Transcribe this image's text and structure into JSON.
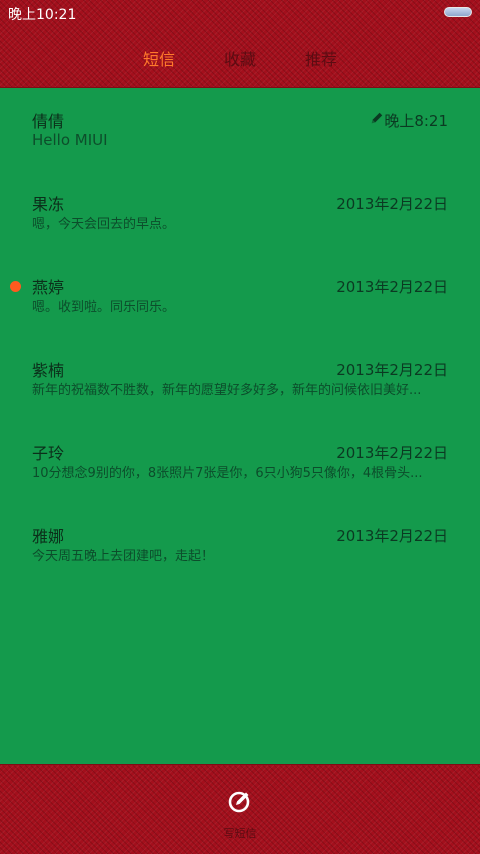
{
  "status_bar": {
    "time": "晚上10:21"
  },
  "tabs": [
    {
      "label": "短信",
      "active": true
    },
    {
      "label": "收藏",
      "active": false
    },
    {
      "label": "推荐",
      "active": false
    }
  ],
  "threads": [
    {
      "name": "倩倩",
      "date": "晚上8:21",
      "preview": "Hello MIUI",
      "draft": true,
      "unread": false
    },
    {
      "name": "果冻",
      "date": "2013年2月22日",
      "preview": "嗯，今天会回去的早点。",
      "draft": false,
      "unread": false
    },
    {
      "name": "燕婷",
      "date": "2013年2月22日",
      "preview": "嗯。收到啦。同乐同乐。",
      "draft": false,
      "unread": true
    },
    {
      "name": "紫楠",
      "date": "2013年2月22日",
      "preview": "新年的祝福数不胜数，新年的愿望好多好多，新年的问候依旧美好...",
      "draft": false,
      "unread": false
    },
    {
      "name": "子玲",
      "date": "2013年2月22日",
      "preview": "10分想念9别的你，8张照片7张是你，6只小狗5只像你，4根骨头...",
      "draft": false,
      "unread": false
    },
    {
      "name": "雅娜",
      "date": "2013年2月22日",
      "preview": "今天周五晚上去团建吧，走起！",
      "draft": false,
      "unread": false
    }
  ],
  "bottom_bar": {
    "compose_label": "写短信",
    "compose_icon": "compose-icon"
  },
  "colors": {
    "header": "#a30f1c",
    "list_bg": "#149a4c",
    "active_tab": "#ff7a2b",
    "unread_dot": "#ff5a1f"
  }
}
